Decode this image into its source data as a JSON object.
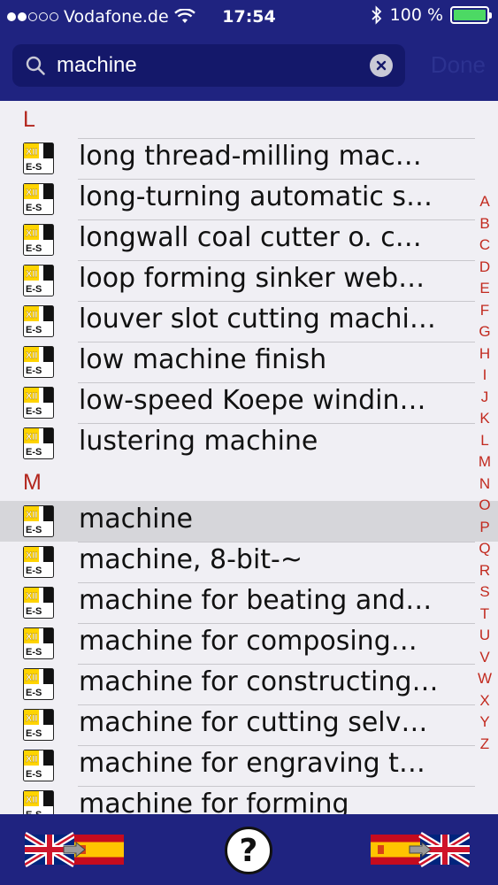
{
  "status_bar": {
    "carrier": "Vodafone.de",
    "time": "17:54",
    "battery": "100 %",
    "battery_level": 1.0
  },
  "search": {
    "value": "machine",
    "done_label": "Done"
  },
  "icon_names": {
    "row": "dictionary-en-es-icon",
    "search": "search-icon",
    "clear": "clear-icon",
    "help": "help-icon"
  },
  "colors": {
    "bar": "#1f2380",
    "section_header": "#b3261e",
    "index": "#c22a1f",
    "battery": "#4cd964"
  },
  "sections": [
    {
      "letter": "L",
      "items": [
        "long thread-milling mac…",
        "long-turning automatic s…",
        "longwall coal cutter o. c…",
        "loop forming sinker web…",
        "louver slot cutting machi…",
        "low machine finish",
        "low-speed Koepe windin…",
        "lustering machine"
      ]
    },
    {
      "letter": "M",
      "selected_index": 0,
      "items": [
        "machine",
        "machine, 8-bit-~",
        "machine for beating and…",
        "machine for composing…",
        "machine for constructing…",
        "machine for cutting selv…",
        "machine for engraving t…",
        "machine for forming"
      ]
    }
  ],
  "index_letters": [
    "A",
    "B",
    "C",
    "D",
    "E",
    "F",
    "G",
    "H",
    "I",
    "J",
    "K",
    "L",
    "M",
    "N",
    "O",
    "P",
    "Q",
    "R",
    "S",
    "T",
    "U",
    "V",
    "W",
    "X",
    "Y",
    "Z"
  ],
  "tab_bar": {
    "help_label": "?"
  }
}
